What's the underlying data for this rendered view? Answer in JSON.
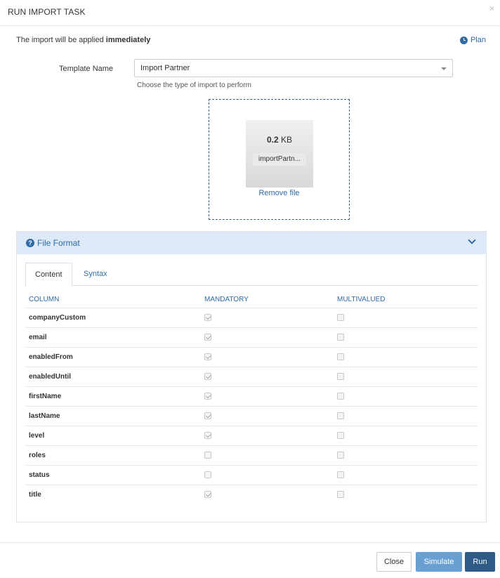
{
  "modal": {
    "title": "RUN IMPORT TASK",
    "close_glyph": "×"
  },
  "notice": {
    "prefix": "The import will be applied ",
    "emphasis": "immediately"
  },
  "plan_link": {
    "label": "Plan",
    "icon": "clock-icon"
  },
  "template": {
    "label": "Template Name",
    "selected": "Import Partner",
    "help": "Choose the type of import to perform"
  },
  "file": {
    "size_value": "0.2",
    "size_unit": "KB",
    "name": "importPartn...",
    "remove_label": "Remove file"
  },
  "file_format": {
    "title": "File Format",
    "tabs": [
      {
        "label": "Content"
      },
      {
        "label": "Syntax"
      }
    ],
    "headers": {
      "column": "COLUMN",
      "mandatory": "MANDATORY",
      "multivalued": "MULTIVALUED"
    },
    "rows": [
      {
        "name": "companyCustom",
        "mandatory": true,
        "multivalued": false
      },
      {
        "name": "email",
        "mandatory": true,
        "multivalued": false
      },
      {
        "name": "enabledFrom",
        "mandatory": true,
        "multivalued": false
      },
      {
        "name": "enabledUntil",
        "mandatory": true,
        "multivalued": false
      },
      {
        "name": "firstName",
        "mandatory": true,
        "multivalued": false
      },
      {
        "name": "lastName",
        "mandatory": true,
        "multivalued": false
      },
      {
        "name": "level",
        "mandatory": true,
        "multivalued": false
      },
      {
        "name": "roles",
        "mandatory": false,
        "multivalued": false
      },
      {
        "name": "status",
        "mandatory": false,
        "multivalued": false
      },
      {
        "name": "title",
        "mandatory": true,
        "multivalued": false
      }
    ]
  },
  "footer": {
    "close_label": "Close",
    "simulate_label": "Simulate",
    "run_label": "Run"
  },
  "colors": {
    "link": "#2f6ba5",
    "panel_header": "#dde9f6",
    "simulate": "#6a9fd1",
    "run": "#2e5a87"
  }
}
